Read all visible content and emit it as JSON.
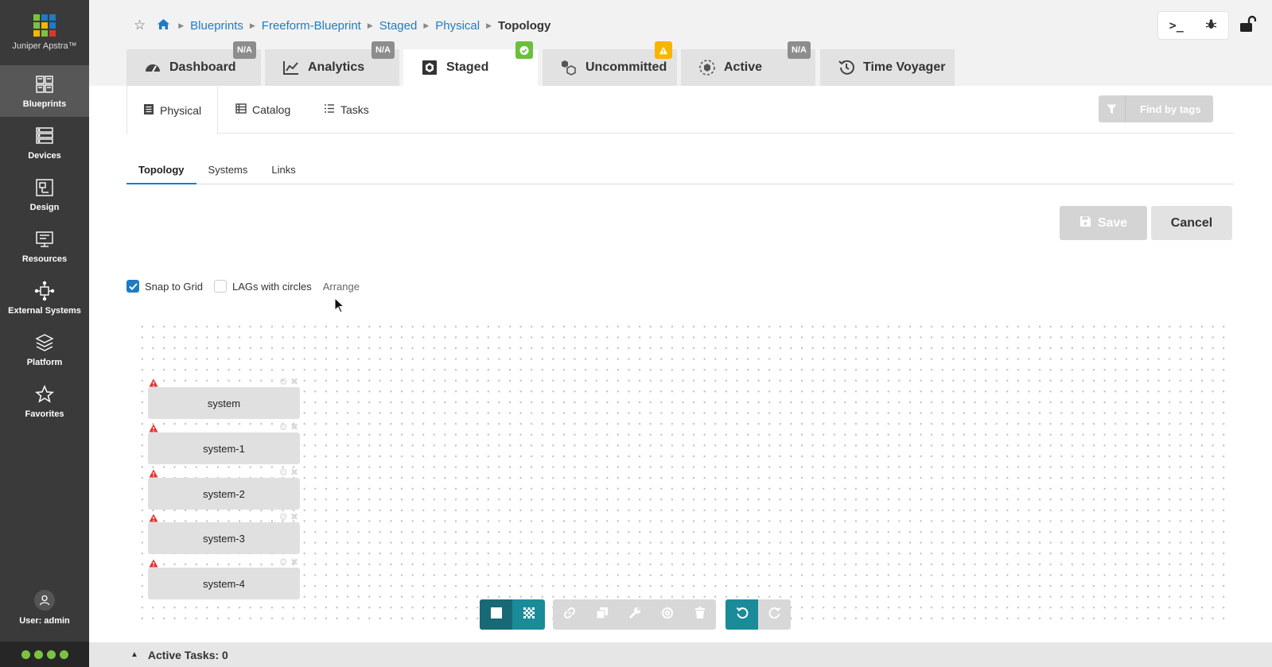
{
  "app": {
    "logo_text": "Juniper Apstra™",
    "logo_colors": [
      "#7cc242",
      "#1d7cc4",
      "#1d7cc4",
      "#7cc242",
      "#f7b500",
      "#1d7cc4",
      "#f7b500",
      "#7cc242",
      "#e4312f"
    ]
  },
  "sidebar": {
    "items": [
      {
        "label": "Blueprints",
        "icon": "blueprints-icon",
        "active": true
      },
      {
        "label": "Devices",
        "icon": "devices-icon"
      },
      {
        "label": "Design",
        "icon": "design-icon"
      },
      {
        "label": "Resources",
        "icon": "resources-icon"
      },
      {
        "label": "External Systems",
        "icon": "external-systems-icon"
      },
      {
        "label": "Platform",
        "icon": "platform-icon"
      },
      {
        "label": "Favorites",
        "icon": "star-icon"
      }
    ],
    "user_label": "User: admin"
  },
  "breadcrumb": [
    "Blueprints",
    "Freeform-Blueprint",
    "Staged",
    "Physical",
    "Topology"
  ],
  "tabs": [
    {
      "label": "Dashboard",
      "badge": "N/A"
    },
    {
      "label": "Analytics",
      "badge": "N/A"
    },
    {
      "label": "Staged",
      "badge": "ok",
      "active": true
    },
    {
      "label": "Uncommitted",
      "badge": "warn"
    },
    {
      "label": "Active",
      "badge": "N/A"
    },
    {
      "label": "Time Voyager",
      "badge": ""
    }
  ],
  "subtabs": [
    "Physical",
    "Catalog",
    "Tasks"
  ],
  "find_by_tags": "Find by tags",
  "view_tabs": [
    "Topology",
    "Systems",
    "Links"
  ],
  "buttons": {
    "save": "Save",
    "cancel": "Cancel"
  },
  "options": {
    "snap_to_grid": "Snap to Grid",
    "snap_checked": true,
    "lags_with_circles": "LAGs with circles",
    "lags_checked": false,
    "arrange": "Arrange"
  },
  "nodes": [
    "system",
    "system-1",
    "system-2",
    "system-3",
    "system-4"
  ],
  "footer": {
    "active_tasks": "Active Tasks: 0"
  },
  "colors": {
    "accent": "#1d7cc4",
    "teal": "#1a8b99",
    "success": "#6abf3b",
    "warning": "#f7b500",
    "error": "#e4312f"
  }
}
